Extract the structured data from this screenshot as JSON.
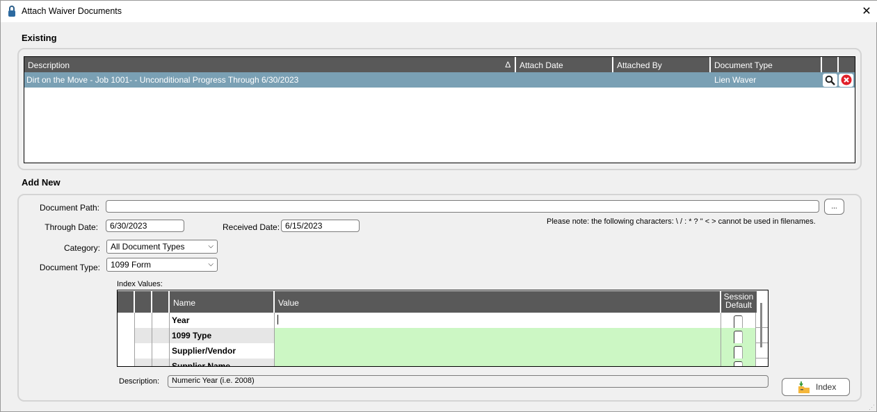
{
  "window": {
    "title": "Attach Waiver Documents",
    "close": "✕"
  },
  "existing": {
    "section_label": "Existing",
    "columns": [
      "Description",
      "Attach Date",
      "Attached By",
      "Document Type"
    ],
    "sort_indicator": "∆",
    "rows": [
      {
        "description": "Dirt on the Move - Job 1001- - Unconditional Progress Through 6/30/2023",
        "attach_date": "",
        "attached_by": "",
        "document_type": "Lien Waver"
      }
    ]
  },
  "add_new": {
    "section_label": "Add New",
    "document_path_label": "Document Path:",
    "document_path_value": "",
    "browse_label": "...",
    "through_date_label": "Through Date:",
    "through_date_value": "6/30/2023",
    "received_date_label": "Received Date:",
    "received_date_value": "6/15/2023",
    "note": "Please note:  the following characters:  \\ / : * ? \" < > cannot be used in filenames.",
    "category_label": "Category:",
    "category_value": "All Document Types",
    "document_type_label": "Document Type:",
    "document_type_value": "1099 Form",
    "index_values_label": "Index Values:",
    "index_columns": [
      "Name",
      "Value",
      "Session",
      "Default"
    ],
    "index_rows": [
      {
        "name": "Year",
        "value": ""
      },
      {
        "name": "1099 Type",
        "value": ""
      },
      {
        "name": "Supplier/Vendor",
        "value": ""
      },
      {
        "name": "Supplier Name",
        "value": ""
      }
    ],
    "description_label": "Description:",
    "description_value": "Numeric Year (i.e. 2008)",
    "index_button": "Index"
  },
  "colors": {
    "header": "#595959",
    "selected_row": "#7aa0b4",
    "required_cell": "#ccf7c4"
  }
}
